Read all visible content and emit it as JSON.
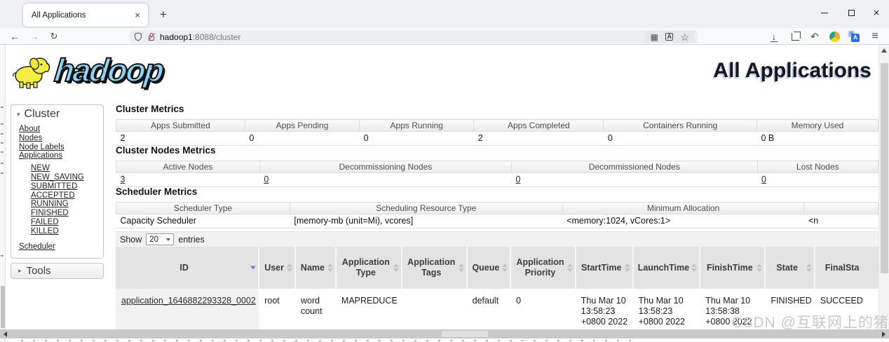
{
  "browser": {
    "tab": {
      "title": "All Applications"
    },
    "url": {
      "host": "hadoop1",
      "path": ":8088/cluster"
    },
    "icons": {
      "back": "←",
      "forward": "→",
      "reload": "↻",
      "new_tab": "+",
      "close_tab": "×",
      "qr": "▦",
      "star": "☆",
      "download": "↓",
      "undo": "↶",
      "menu": "≡",
      "close_window": "×",
      "translate_a": "A",
      "translate_b": "a",
      "collapse": "▾",
      "expand": "▸"
    }
  },
  "page": {
    "logo_text": "hadoop",
    "title": "All Applications",
    "sidebar": {
      "cluster_header": "Cluster",
      "links": [
        "About",
        "Nodes",
        "Node Labels",
        "Applications"
      ],
      "app_states": [
        "NEW",
        "NEW_SAVING",
        "SUBMITTED",
        "ACCEPTED",
        "RUNNING",
        "FINISHED",
        "FAILED",
        "KILLED"
      ],
      "scheduler_link": "Scheduler",
      "tools_header": "Tools"
    },
    "cluster_metrics": {
      "title": "Cluster Metrics",
      "headers": [
        "Apps Submitted",
        "Apps Pending",
        "Apps Running",
        "Apps Completed",
        "Containers Running",
        "Memory Used"
      ],
      "values": [
        "2",
        "0",
        "0",
        "2",
        "0",
        "0 B"
      ]
    },
    "cluster_nodes_metrics": {
      "title": "Cluster Nodes Metrics",
      "headers": [
        "Active Nodes",
        "Decommissioning Nodes",
        "Decommissioned Nodes",
        "Lost Nodes"
      ],
      "values": [
        "3",
        "0",
        "0",
        "0"
      ]
    },
    "scheduler_metrics": {
      "title": "Scheduler Metrics",
      "headers": [
        "Scheduler Type",
        "Scheduling Resource Type",
        "Minimum Allocation",
        ""
      ],
      "values": [
        "Capacity Scheduler",
        "[memory-mb (unit=Mi), vcores]",
        "<memory:1024, vCores:1>",
        "<n"
      ]
    },
    "apps_table": {
      "show_label": "Show",
      "page_size": "20",
      "entries_label": "entries",
      "columns": [
        "ID",
        "User",
        "Name",
        "Application Type",
        "Application Tags",
        "Queue",
        "Application Priority",
        "StartTime",
        "LaunchTime",
        "FinishTime",
        "State",
        "FinalSta"
      ],
      "row": {
        "id": "application_1646882293328_0002",
        "user": "root",
        "name": "word count",
        "application_type": "MAPREDUCE",
        "application_tags": "",
        "queue": "default",
        "application_priority": "0",
        "start_time": "Thu Mar 10 13:58:23 +0800 2022",
        "launch_time": "Thu Mar 10 13:58:23 +0800 2022",
        "finish_time": "Thu Mar 10 13:58:38 +0800 2022",
        "state": "FINISHED",
        "final_status": "SUCCEED"
      }
    },
    "watermark": "CSDN @互联网上的猪",
    "colors": {
      "logo_blue": "#8fd2f4",
      "sort_active": "#6b7bd6",
      "header_bg": "#e3e3e3"
    }
  }
}
